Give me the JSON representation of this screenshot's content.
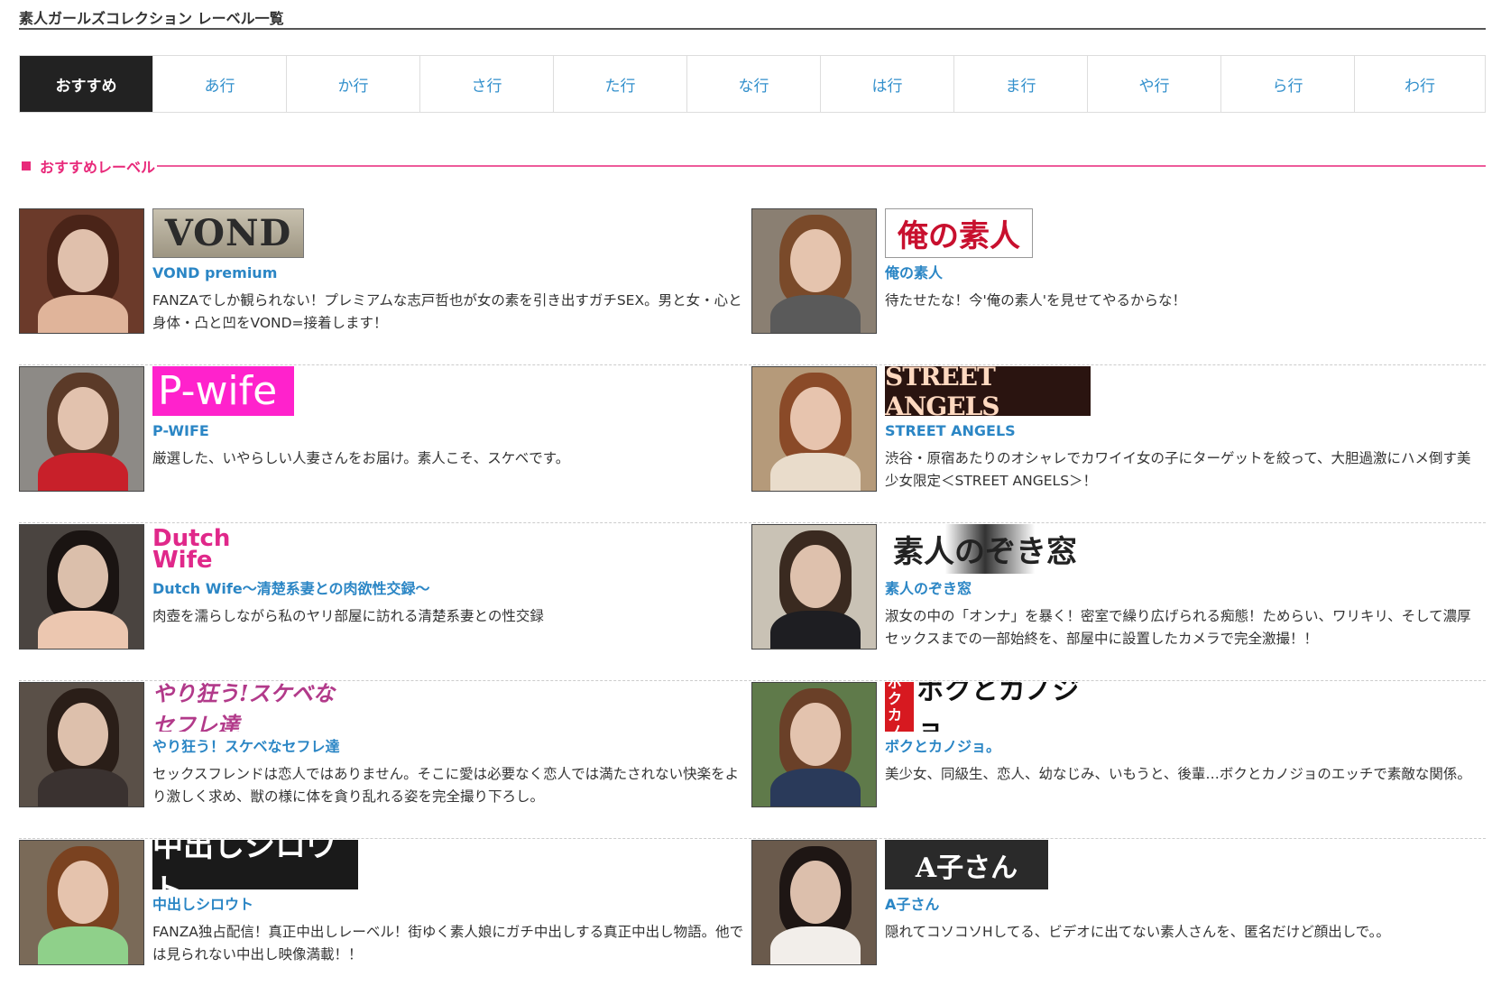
{
  "page_title": "素人ガールズコレクション レーベル一覧",
  "tabs": [
    {
      "label": "おすすめ",
      "active": true
    },
    {
      "label": "あ行"
    },
    {
      "label": "か行"
    },
    {
      "label": "さ行"
    },
    {
      "label": "た行"
    },
    {
      "label": "な行"
    },
    {
      "label": "は行"
    },
    {
      "label": "ま行"
    },
    {
      "label": "や行"
    },
    {
      "label": "ら行"
    },
    {
      "label": "わ行"
    }
  ],
  "section_heading": "おすすめレーベル",
  "colors": {
    "accent_pink": "#e8297a",
    "link_blue": "#2b86c5",
    "active_tab_bg": "#222222"
  },
  "labels": [
    {
      "name": "VOND premium",
      "logo_text": "VOND",
      "description": "FANZAでしか観られない！プレミアムな志戸哲也が女の素を引き出すガチSEX。男と女・心と身体・凸と凹をVOND=接着します！"
    },
    {
      "name": "俺の素人",
      "logo_text": "俺の素人",
      "description": "待たせたな！今'俺の素人'を見せてやるからな！"
    },
    {
      "name": "P-WIFE",
      "logo_text": "P-wife",
      "description": "厳選した、いやらしい人妻さんをお届け。素人こそ、スケベです。"
    },
    {
      "name": "STREET ANGELS",
      "logo_text": "STREET ANGELS",
      "description": "渋谷・原宿あたりのオシャレでカワイイ女の子にターゲットを絞って、大胆過激にハメ倒す美少女限定＜STREET ANGELS＞！"
    },
    {
      "name": "Dutch Wife～清楚系妻との肉欲性交録～",
      "logo_text": "Dutch Wife",
      "description": "肉壺を濡らしながら私のヤリ部屋に訪れる清楚系妻との性交録"
    },
    {
      "name": "素人のぞき窓",
      "logo_text": "素人のぞき窓",
      "description": "淑女の中の「オンナ」を暴く！密室で繰り広げられる痴態！ためらい、ワリキリ、そして濃厚セックスまでの一部始終を、部屋中に設置したカメラで完全激撮！！"
    },
    {
      "name": "やり狂う！スケベなセフレ達",
      "logo_text": "やり狂う!スケベなセフレ達",
      "description": "セックスフレンドは恋人ではありません。そこに愛は必要なく恋人では満たされない快楽をより激しく求め、獣の様に体を貪り乱れる姿を完全撮り下ろし。"
    },
    {
      "name": "ボクとカノジョ。",
      "logo_text": "ボクとカノジョ。",
      "description": "美少女、同級生、恋人、幼なじみ、いもうと、後輩…ボクとカノジョのエッチで素敵な関係。"
    },
    {
      "name": "中出しシロウト",
      "logo_text": "中出しシロウト",
      "description": "FANZA独占配信！真正中出しレーベル！街ゆく素人娘にガチ中出しする真正中出し物語。他では見られない中出し映像満載！！"
    },
    {
      "name": "A子さん",
      "logo_text": "A子さん",
      "description": "隠れてコソコソHしてる、ビデオに出てない素人さんを、匿名だけど顔出しで。。"
    }
  ]
}
